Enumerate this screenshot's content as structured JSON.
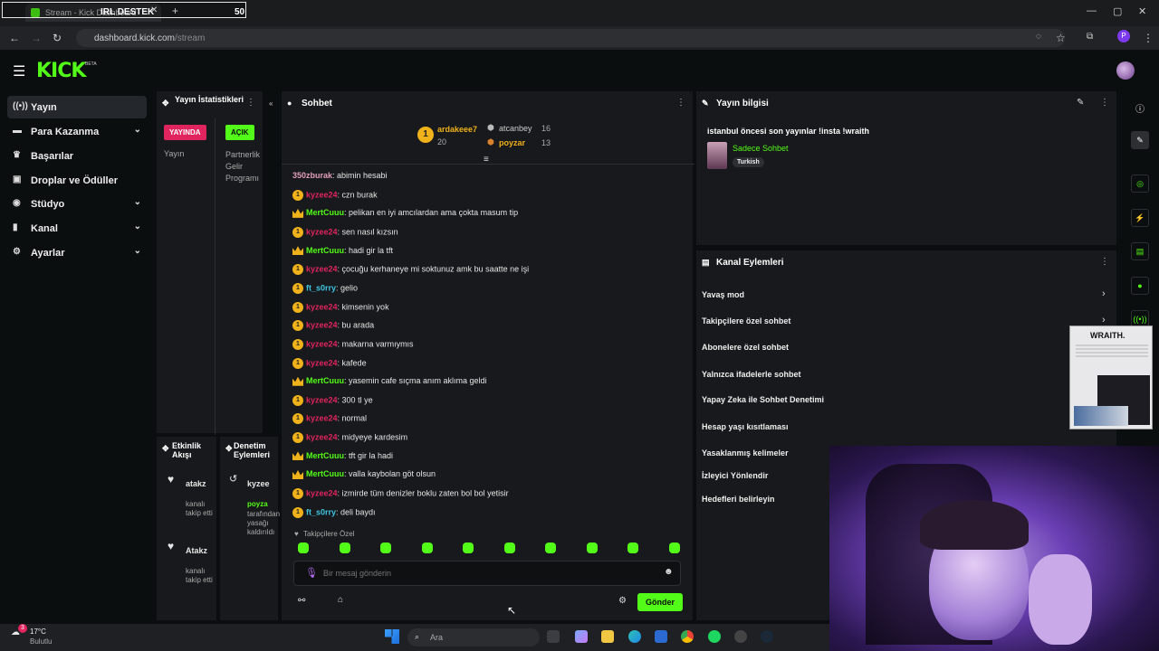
{
  "browser": {
    "tab_title": "Stream - Kick Dashboard",
    "overlay_text": "IRL DESTEK",
    "overlay_number": "50",
    "url_domain": "dashboard.kick.com",
    "url_path": "/stream",
    "profile_initial": "P"
  },
  "sidebar": {
    "items": [
      {
        "label": "Yayın",
        "icon": "broadcast-icon"
      },
      {
        "label": "Para Kazanma",
        "icon": "money-icon"
      },
      {
        "label": "Başarılar",
        "icon": "trophy-icon"
      },
      {
        "label": "Droplar ve Ödüller",
        "icon": "gift-icon"
      },
      {
        "label": "Stüdyo",
        "icon": "studio-icon"
      },
      {
        "label": "Kanal",
        "icon": "channel-icon"
      },
      {
        "label": "Ayarlar",
        "icon": "gear-icon"
      }
    ]
  },
  "stats": {
    "title": "Yayın İstatistikleri",
    "live_badge": "YAYINDA",
    "open_badge": "AÇIK",
    "live_label": "Yayın",
    "partner_label": "Partnerlik Gelir Programı"
  },
  "activity": {
    "title": "Etkinlik Akışı",
    "items": [
      {
        "user": "atakz",
        "text": "kanalı takip etti"
      },
      {
        "user": "Atakz",
        "text": "kanalı takip etti"
      }
    ]
  },
  "moderation": {
    "title": "Denetim Eylemleri",
    "user": "kyzee",
    "actor": "poyza",
    "text": "tarafından yasağı kaldırıldı"
  },
  "chat": {
    "title": "Sohbet",
    "top_gifters": [
      {
        "rank": "1",
        "name": "ardakeee7",
        "count": "20"
      },
      {
        "rank": "",
        "name": "atcanbey",
        "count": "16"
      },
      {
        "rank": "",
        "name": "poyzar",
        "count": "13"
      }
    ],
    "messages": [
      {
        "badge": "",
        "user": "350zburak",
        "color": "pink",
        "text": "abimin hesabi"
      },
      {
        "badge": "1",
        "user": "kyzee24",
        "color": "red",
        "text": "czn burak"
      },
      {
        "badge": "crown",
        "user": "MertCuuu",
        "color": "green",
        "text": "pelikan en iyi amcılardan ama çokta masum tip"
      },
      {
        "badge": "1",
        "user": "kyzee24",
        "color": "red",
        "text": "sen nasıl kızsın"
      },
      {
        "badge": "crown",
        "user": "MertCuuu",
        "color": "green",
        "text": "hadi gir la tft"
      },
      {
        "badge": "1",
        "user": "kyzee24",
        "color": "red",
        "text": "çocuğu kerhaneye mi soktunuz amk bu saatte ne işi"
      },
      {
        "badge": "1",
        "user": "ft_s0rry",
        "color": "teal",
        "text": "gelio"
      },
      {
        "badge": "1",
        "user": "kyzee24",
        "color": "red",
        "text": "kimsenin yok"
      },
      {
        "badge": "1",
        "user": "kyzee24",
        "color": "red",
        "text": "bu arada"
      },
      {
        "badge": "1",
        "user": "kyzee24",
        "color": "red",
        "text": "makarna varmıymıs"
      },
      {
        "badge": "1",
        "user": "kyzee24",
        "color": "red",
        "text": "kafede"
      },
      {
        "badge": "crown",
        "user": "MertCuuu",
        "color": "green",
        "text": "yasemin cafe sıçma anım aklıma geldi"
      },
      {
        "badge": "1",
        "user": "kyzee24",
        "color": "red",
        "text": "300 tl ye"
      },
      {
        "badge": "1",
        "user": "kyzee24",
        "color": "red",
        "text": "normal"
      },
      {
        "badge": "1",
        "user": "kyzee24",
        "color": "red",
        "text": "midyeye kardesim"
      },
      {
        "badge": "crown",
        "user": "MertCuuu",
        "color": "green",
        "text": "tft gir la hadi"
      },
      {
        "badge": "crown",
        "user": "MertCuuu",
        "color": "green",
        "text": "valla kaybolan göt olsun"
      },
      {
        "badge": "1",
        "user": "kyzee24",
        "color": "red",
        "text": "izmirde tüm denizler boklu zaten bol bol yetisir"
      },
      {
        "badge": "1",
        "user": "ft_s0rry",
        "color": "teal",
        "text": "deli baydı"
      }
    ],
    "followers_only_label": "Takipçilere Özel",
    "input_placeholder": "Bir mesaj gönderin",
    "send_label": "Gönder"
  },
  "stream_info": {
    "title": "Yayın bilgisi",
    "stream_title": "istanbul öncesi son yayınlar !insta !wraith",
    "category": "Sadece Sohbet",
    "language": "Turkish"
  },
  "channel_actions": {
    "title": "Kanal Eylemleri",
    "items": [
      "Yavaş mod",
      "Takipçilere özel sohbet",
      "Abonelere özel sohbet",
      "Yalnızca ifadelerle sohbet",
      "Yapay Zeka ile Sohbet Denetimi",
      "Hesap yaşı kısıtlaması",
      "Yasaklanmış kelimeler",
      "İzleyici Yönlendir",
      "Hedefleri belirleyin"
    ]
  },
  "taskbar": {
    "weather_temp": "17°C",
    "weather_desc": "Bulutlu",
    "notification_count": "3",
    "search_placeholder": "Ara"
  },
  "overlay_ad": {
    "brand": "WRAITH."
  },
  "colors": {
    "kick_green": "#53fc18",
    "live_red": "#e0245e",
    "panel_bg": "#18191c",
    "page_bg": "#0b0e0f"
  }
}
